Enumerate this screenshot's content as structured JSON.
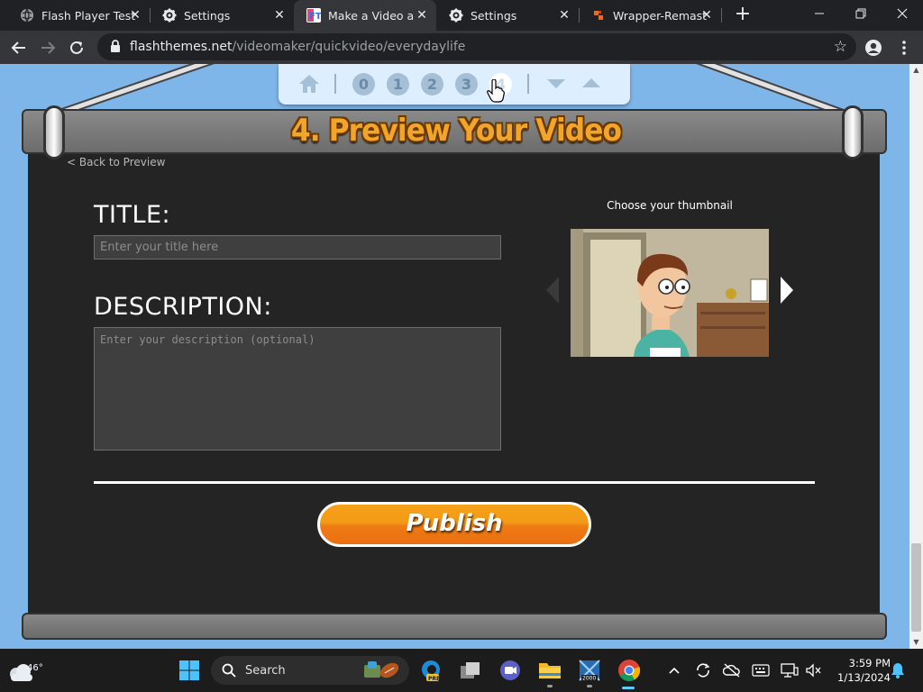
{
  "browser": {
    "tabs": [
      {
        "title": "Flash Player Test",
        "icon": "globe-icon",
        "active": false
      },
      {
        "title": "Settings",
        "icon": "gear-icon",
        "active": false
      },
      {
        "title": "Make a Video abo",
        "icon": "flashthemes-icon",
        "active": true
      },
      {
        "title": "Settings",
        "icon": "gear-icon",
        "active": false
      },
      {
        "title": "Wrapper-Remaste",
        "icon": "wrapper-icon",
        "active": false
      }
    ],
    "url_host": "flashthemes.net",
    "url_path": "/videomaker/quickvideo/everydaylife"
  },
  "page": {
    "step_nav": {
      "steps": [
        "0",
        "1",
        "2",
        "3",
        "4"
      ]
    },
    "banner_title": "4. Preview Your Video",
    "back_link": "< Back to Preview",
    "title_label": "TITLE:",
    "title_placeholder": "Enter your title here",
    "description_label": "DESCRIPTION:",
    "description_placeholder": "Enter your description (optional)",
    "thumbnail_label": "Choose your thumbnail",
    "publish_label": "Publish"
  },
  "taskbar": {
    "weather_temp": "46°",
    "search_label": "Search",
    "time": "3:59 PM",
    "date": "1/13/2024"
  },
  "colors": {
    "page_bg": "#7fb6ea",
    "panel_bg": "#242424",
    "banner_text": "#f2a52b",
    "publish_orange": "#ef8514"
  }
}
